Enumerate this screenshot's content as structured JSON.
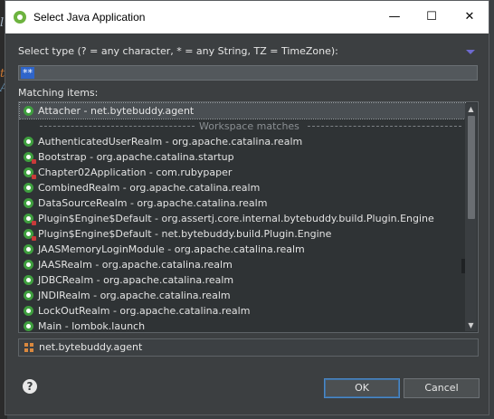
{
  "window": {
    "title": "Select Java Application",
    "controls": {
      "minimize": "—",
      "maximize": "☐",
      "close": "✕"
    }
  },
  "filter": {
    "label": "Select type (? = any character, * = any String, TZ = TimeZone):",
    "value": "**"
  },
  "matching": {
    "label": "Matching items:",
    "history_items": [
      {
        "text": "Attacher - net.bytebuddy.agent",
        "selected": true
      }
    ],
    "separator": "Workspace matches",
    "items": [
      {
        "text": "AuthenticatedUserRealm - org.apache.catalina.realm",
        "decorated": false
      },
      {
        "text": "Bootstrap - org.apache.catalina.startup",
        "decorated": true
      },
      {
        "text": "Chapter02Application - com.rubypaper",
        "decorated": true
      },
      {
        "text": "CombinedRealm - org.apache.catalina.realm",
        "decorated": false
      },
      {
        "text": "DataSourceRealm - org.apache.catalina.realm",
        "decorated": false
      },
      {
        "text": "Plugin$Engine$Default - org.assertj.core.internal.bytebuddy.build.Plugin.Engine",
        "decorated": true
      },
      {
        "text": "Plugin$Engine$Default - net.bytebuddy.build.Plugin.Engine",
        "decorated": true
      },
      {
        "text": "JAASMemoryLoginModule - org.apache.catalina.realm",
        "decorated": false
      },
      {
        "text": "JAASRealm - org.apache.catalina.realm",
        "decorated": false
      },
      {
        "text": "JDBCRealm - org.apache.catalina.realm",
        "decorated": false
      },
      {
        "text": "JNDIRealm - org.apache.catalina.realm",
        "decorated": false
      },
      {
        "text": "LockOutRealm - org.apache.catalina.realm",
        "decorated": false
      },
      {
        "text": "Main - lombok.launch",
        "decorated": false
      }
    ],
    "scroll_up": "▲",
    "scroll_down": "▼"
  },
  "status": {
    "icon": "package-icon",
    "text": "net.bytebuddy.agent"
  },
  "buttons": {
    "help": "?",
    "ok": "OK",
    "cancel": "Cancel"
  },
  "colors": {
    "background": "#3c3f41",
    "selection": "#2f65ca",
    "class_icon": "#3f9f3f",
    "package_icon": "#d9883e"
  }
}
